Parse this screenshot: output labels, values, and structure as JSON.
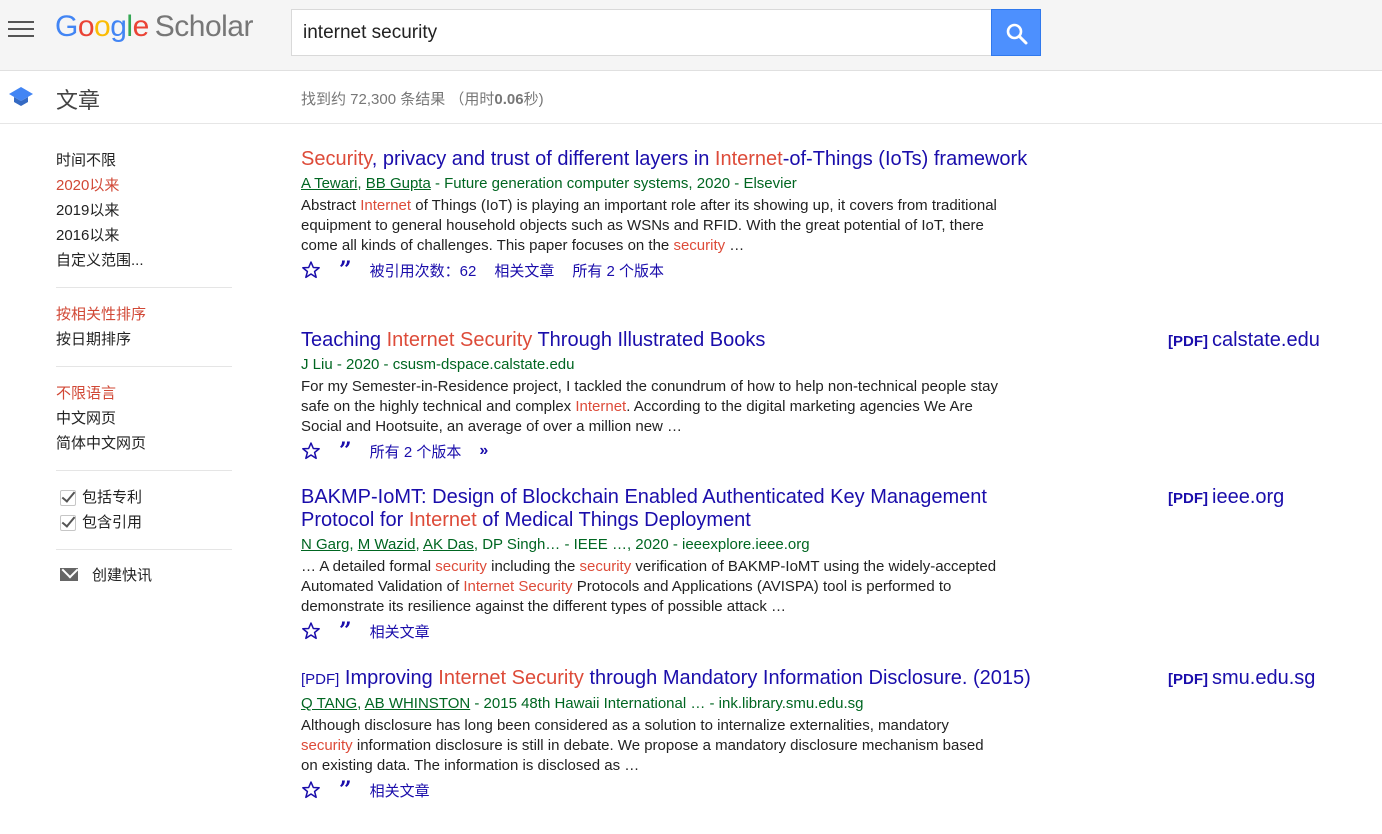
{
  "header": {
    "logo_google": [
      "G",
      "o",
      "o",
      "g",
      "l",
      "e"
    ],
    "logo_scholar": "Scholar",
    "search_value": "internet security"
  },
  "subheader": {
    "section_title": "文章",
    "count_prefix": "找到约 72,300 条结果 （用时",
    "count_time": "0.06",
    "count_suffix": "秒)"
  },
  "sidebar": {
    "time_filters": [
      "时间不限",
      "2020以来",
      "2019以来",
      "2016以来",
      "自定义范围..."
    ],
    "time_active_index": 1,
    "sort_filters": [
      "按相关性排序",
      "按日期排序"
    ],
    "sort_active_index": 0,
    "lang_filters": [
      "不限语言",
      "中文网页",
      "简体中文网页"
    ],
    "lang_active_index": 0,
    "checks": [
      "包括专利",
      "包含引用"
    ],
    "alert": "创建快讯"
  },
  "results": [
    {
      "title": [
        {
          "t": "Security",
          "hl": true
        },
        {
          "t": ", privacy and trust of different layers in ",
          "hl": false
        },
        {
          "t": "Internet",
          "hl": true
        },
        {
          "t": "-of-Things (IoTs) framework",
          "hl": false
        }
      ],
      "authors": [
        "A Tewari",
        "BB Gupta"
      ],
      "meta_tail": " - Future generation computer systems, 2020 - Elsevier",
      "snippet": [
        {
          "t": "Abstract ",
          "hl": false
        },
        {
          "t": "Internet",
          "hl": true
        },
        {
          "t": " of Things (IoT) is playing an important role after its showing up, it covers from traditional equipment to general household objects such as WSNs and RFID. With the great potential of IoT, there come all kinds of challenges. This paper focuses on the ",
          "hl": false
        },
        {
          "t": "security",
          "hl": true
        },
        {
          "t": "  …",
          "hl": false
        }
      ],
      "actions": [
        "被引用次数：62",
        "相关文章",
        "所有 2 个版本"
      ],
      "pdf_tag": "",
      "pdf_domain": ""
    },
    {
      "title": [
        {
          "t": "Teaching ",
          "hl": false
        },
        {
          "t": "Internet Security",
          "hl": true
        },
        {
          "t": " Through Illustrated Books",
          "hl": false
        }
      ],
      "authors": [],
      "meta_tail": "J Liu - 2020 - csusm-dspace.calstate.edu",
      "snippet": [
        {
          "t": "For my Semester-in-Residence project, I tackled the conundrum of how to help non-technical people stay safe on the highly technical and complex ",
          "hl": false
        },
        {
          "t": "Internet",
          "hl": true
        },
        {
          "t": ". According to the digital marketing agencies We Are Social and Hootsuite, an average of over a million new …",
          "hl": false
        }
      ],
      "actions": [
        "所有 2 个版本"
      ],
      "more": "»",
      "pdf_tag": "[PDF]",
      "pdf_domain": "calstate.edu"
    },
    {
      "title": [
        {
          "t": "BAKMP-IoMT: Design of Blockchain Enabled Authenticated Key Management Protocol for ",
          "hl": false
        },
        {
          "t": "Internet",
          "hl": true
        },
        {
          "t": " of Medical Things Deployment",
          "hl": false
        }
      ],
      "authors": [
        "N Garg",
        "M Wazid",
        "AK Das"
      ],
      "meta_tail": ", DP Singh… - IEEE …, 2020 - ieeexplore.ieee.org",
      "snippet": [
        {
          "t": "… A detailed formal ",
          "hl": false
        },
        {
          "t": "security",
          "hl": true
        },
        {
          "t": " including the ",
          "hl": false
        },
        {
          "t": "security",
          "hl": true
        },
        {
          "t": " verification of BAKMP-IoMT using the widely-accepted Automated Validation of ",
          "hl": false
        },
        {
          "t": "Internet Security",
          "hl": true
        },
        {
          "t": " Protocols and Applications (AVISPA) tool is performed to demonstrate its resilience against the different types of possible attack …",
          "hl": false
        }
      ],
      "actions": [
        "相关文章"
      ],
      "pdf_tag": "[PDF]",
      "pdf_domain": "ieee.org"
    },
    {
      "title_tag": "[PDF]",
      "title": [
        {
          "t": " Improving ",
          "hl": false
        },
        {
          "t": "Internet Security",
          "hl": true
        },
        {
          "t": " through Mandatory Information Disclosure. (2015)",
          "hl": false
        }
      ],
      "authors": [
        "Q TANG",
        "AB WHINSTON"
      ],
      "meta_tail": " - 2015 48th Hawaii International … - ink.library.smu.edu.sg",
      "snippet": [
        {
          "t": "Although disclosure has long been considered as a solution to internalize externalities, mandatory ",
          "hl": false
        },
        {
          "t": "security",
          "hl": true
        },
        {
          "t": " information disclosure is still in debate. We propose a mandatory disclosure mechanism based on existing data. The information is disclosed as …",
          "hl": false
        }
      ],
      "actions": [
        "相关文章"
      ],
      "pdf_tag": "[PDF]",
      "pdf_domain": "smu.edu.sg"
    }
  ]
}
